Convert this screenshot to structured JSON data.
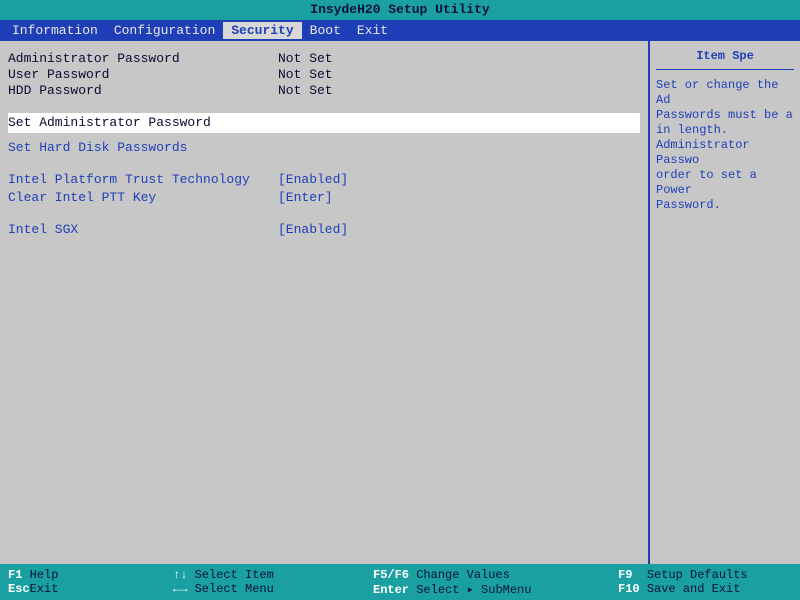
{
  "title": "InsydeH20 Setup Utility",
  "menu": {
    "items": [
      "Information",
      "Configuration",
      "Security",
      "Boot",
      "Exit"
    ],
    "active_index": 2
  },
  "security": {
    "status": [
      {
        "label": "Administrator Password",
        "value": "Not Set"
      },
      {
        "label": "User Password",
        "value": "Not Set"
      },
      {
        "label": "HDD Password",
        "value": "Not Set"
      }
    ],
    "actions": [
      {
        "label": "Set Administrator Password",
        "value": "",
        "selected": true
      },
      {
        "label": "Set Hard Disk Passwords",
        "value": "",
        "selected": false
      }
    ],
    "options": [
      {
        "label": "Intel Platform Trust Technology",
        "value": "[Enabled]"
      },
      {
        "label": "Clear Intel PTT Key",
        "value": "[Enter]"
      }
    ],
    "options2": [
      {
        "label": "Intel SGX",
        "value": "[Enabled]"
      }
    ]
  },
  "help": {
    "title": "Item Spe",
    "body": "Set or change the Ad\n Passwords must be a\n in length.\nAdministrator Passwo\norder to set a Power\n Password."
  },
  "footer": {
    "col1": [
      {
        "key": "F1",
        "text": "Help"
      },
      {
        "key": "Esc",
        "text": "Exit"
      }
    ],
    "col2": [
      {
        "key": "↑↓",
        "text": "Select Item"
      },
      {
        "key": "←→",
        "text": "Select Menu"
      }
    ],
    "col3": [
      {
        "key": "F5/F6",
        "text": "Change Values"
      },
      {
        "key": "Enter",
        "text": "Select ▸ SubMenu"
      }
    ],
    "col4": [
      {
        "key": "F9",
        "text": "Setup Defaults"
      },
      {
        "key": "F10",
        "text": "Save and Exit"
      }
    ]
  }
}
